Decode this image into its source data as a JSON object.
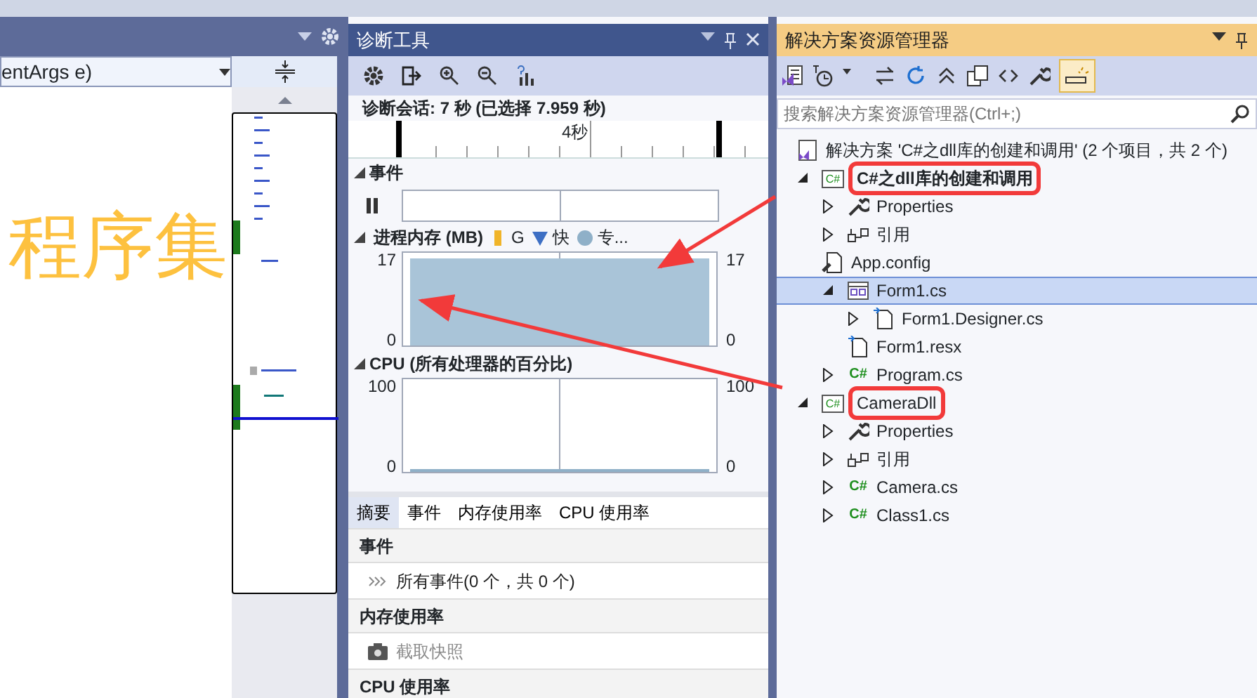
{
  "editor": {
    "member_dropdown": "entArgs e)"
  },
  "diagnostics": {
    "title": "诊断工具",
    "session": "诊断会话: 7 秒 (已选择 7.959 秒)",
    "ruler_label": "4秒",
    "events": {
      "title": "事件",
      "expanded": true
    },
    "memory": {
      "title": "进程内存 (MB)",
      "expanded": true,
      "legend": [
        {
          "kind": "gc",
          "label": "G",
          "color": "#f0b429"
        },
        {
          "kind": "snapshot",
          "label": "快",
          "color": "#3d6fc4"
        },
        {
          "kind": "private",
          "label": "专...",
          "color": "#8fb0c8"
        }
      ],
      "left_ticks": [
        "17",
        "0"
      ],
      "right_ticks": [
        "17",
        "0"
      ]
    },
    "cpu": {
      "title": "CPU (所有处理器的百分比)",
      "expanded": true,
      "left_ticks": [
        "100",
        "0"
      ],
      "right_ticks": [
        "100",
        "0"
      ]
    },
    "tabs": [
      {
        "label": "摘要",
        "selected": true
      },
      {
        "label": "事件",
        "selected": false
      },
      {
        "label": "内存使用率",
        "selected": false
      },
      {
        "label": "CPU 使用率",
        "selected": false
      }
    ],
    "summary": [
      {
        "heading": "事件",
        "item": {
          "kind": "events",
          "label": "所有事件(0 个，共 0 个)",
          "disabled": false
        }
      },
      {
        "heading": "内存使用率",
        "item": {
          "kind": "snapshot",
          "label": "截取快照",
          "disabled": true
        }
      },
      {
        "heading": "CPU 使用率"
      }
    ]
  },
  "solution_explorer": {
    "title": "解决方案资源管理器",
    "search": {
      "placeholder": "搜索解决方案资源管理器(Ctrl+;)"
    },
    "tree": [
      {
        "kind": "solution",
        "label": "解决方案 'C#之dll库的创建和调用' (2 个项目，共 2 个)",
        "selected": false,
        "children": [
          {
            "kind": "project",
            "icon_text": "C#",
            "label": "C#之dll库的创建和调用",
            "bold": true,
            "expanded": true,
            "selected": false,
            "boxed": true,
            "children": [
              {
                "kind": "wrench",
                "label": "Properties",
                "expanded": false,
                "selected": false
              },
              {
                "kind": "references",
                "label": "引用",
                "expanded": false,
                "selected": false
              },
              {
                "kind": "config",
                "label": "App.config",
                "selected": false
              },
              {
                "kind": "form",
                "label": "Form1.cs",
                "expanded": true,
                "selected": true,
                "children": [
                  {
                    "kind": "file",
                    "label": "Form1.Designer.cs",
                    "expanded": false,
                    "selected": false
                  },
                  {
                    "kind": "file",
                    "label": "Form1.resx",
                    "selected": false
                  }
                ]
              },
              {
                "kind": "csharp",
                "icon_text": "C#",
                "label": "Program.cs",
                "expanded": false,
                "selected": false
              }
            ]
          },
          {
            "kind": "project",
            "icon_text": "C#",
            "label": "CameraDll",
            "bold": false,
            "expanded": true,
            "selected": false,
            "boxed": true,
            "children": [
              {
                "kind": "wrench",
                "label": "Properties",
                "expanded": false,
                "selected": false
              },
              {
                "kind": "references",
                "label": "引用",
                "expanded": false,
                "selected": false
              },
              {
                "kind": "csharp",
                "icon_text": "C#",
                "label": "Camera.cs",
                "expanded": false,
                "selected": false
              },
              {
                "kind": "csharp",
                "icon_text": "C#",
                "label": "Class1.cs",
                "expanded": false,
                "selected": false
              }
            ]
          }
        ]
      }
    ]
  },
  "annotation": {
    "text": "程序集"
  }
}
